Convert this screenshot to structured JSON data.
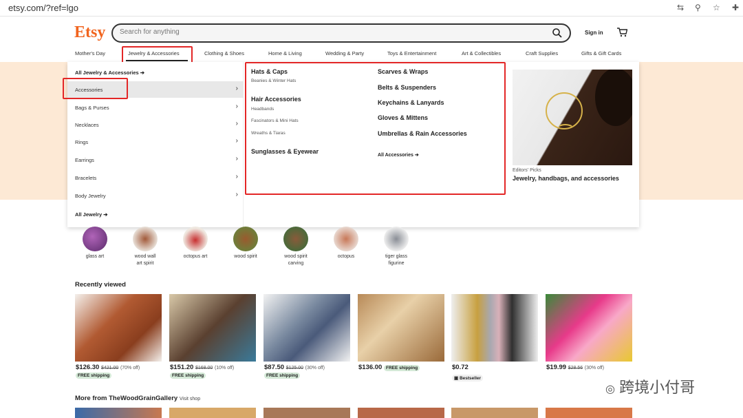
{
  "browser": {
    "url": "etsy.com/?ref=lgo"
  },
  "header": {
    "logo": "Etsy",
    "search_placeholder": "Search for anything",
    "signin": "Sign in"
  },
  "nav": [
    "Mother's Day",
    "Jewelry & Accessories",
    "Clothing & Shoes",
    "Home & Living",
    "Wedding & Party",
    "Toys & Entertainment",
    "Art & Collectibles",
    "Craft Supplies",
    "Gifts & Gift Cards"
  ],
  "menu": {
    "all_link": "All Jewelry & Accessories",
    "left": [
      "Accessories",
      "Bags & Purses",
      "Necklaces",
      "Rings",
      "Earrings",
      "Bracelets",
      "Body Jewelry"
    ],
    "all_jewelry": "All Jewelry",
    "col1": {
      "hats": "Hats & Caps",
      "hats_sub": "Beanies & Winter Hats",
      "hair": "Hair Accessories",
      "hair_sub1": "Headbands",
      "hair_sub2": "Fascinators & Mini Hats",
      "hair_sub3": "Wreaths & Tiaras",
      "sun": "Sunglasses & Eyewear"
    },
    "col2": [
      "Scarves & Wraps",
      "Belts & Suspenders",
      "Keychains & Lanyards",
      "Gloves & Mittens",
      "Umbrellas & Rain Accessories"
    ],
    "all_accessories": "All Accessories",
    "editors_label": "Editors' Picks",
    "editors_title": "Jewelry, handbags, and accessories"
  },
  "searches": [
    {
      "l1": "glass art",
      "l2": ""
    },
    {
      "l1": "wood wall",
      "l2": "art spirit"
    },
    {
      "l1": "octopus art",
      "l2": ""
    },
    {
      "l1": "wood spirit",
      "l2": ""
    },
    {
      "l1": "wood spirit",
      "l2": "carving"
    },
    {
      "l1": "octopus",
      "l2": ""
    },
    {
      "l1": "tiger glass",
      "l2": "figurine"
    }
  ],
  "recently_viewed": "Recently viewed",
  "products": [
    {
      "price": "$126.30",
      "orig": "$421.00",
      "off": "(70% off)",
      "badge": "FREE shipping"
    },
    {
      "price": "$151.20",
      "orig": "$168.00",
      "off": "(10% off)",
      "badge": "FREE shipping"
    },
    {
      "price": "$87.50",
      "orig": "$125.00",
      "off": "(30% off)",
      "badge": "FREE shipping"
    },
    {
      "price": "$136.00",
      "orig": "",
      "off": "",
      "badge": "FREE shipping"
    },
    {
      "price": "$0.72",
      "orig": "",
      "off": "",
      "badge": "Bestseller"
    },
    {
      "price": "$19.99",
      "orig": "$28.56",
      "off": "(30% off)",
      "badge": ""
    }
  ],
  "more_from": "More from TheWoodGrainGallery",
  "visit_shop": "Visit shop",
  "watermark": "跨境小付哥"
}
